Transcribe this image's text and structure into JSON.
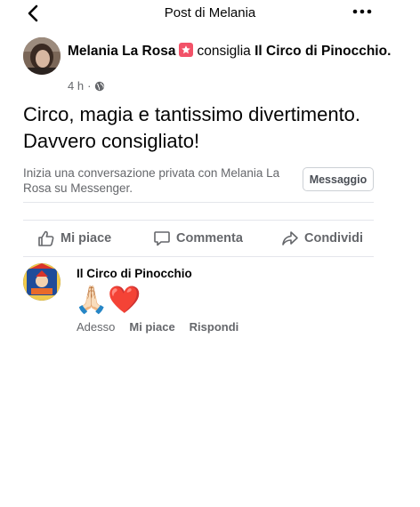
{
  "header": {
    "title": "Post di Melania",
    "back_icon": "chevron-left-icon",
    "more_icon": "more-dots-icon"
  },
  "post": {
    "author": "Melania La Rosa",
    "badge_icon": "recommendation-star-icon",
    "verb": "consiglia",
    "page_name": "Il Circo di Pinocchio.",
    "time": "4 h",
    "separator": "·",
    "privacy_icon": "globe-icon",
    "text": "Circo, magia e tantissimo divertimento. Davvero consigliato!"
  },
  "messenger": {
    "prompt": "Inizia una conversazione privata con Melania La Rosa su Messenger.",
    "button_label": "Messaggio"
  },
  "actions": {
    "like_label": "Mi piace",
    "comment_label": "Commenta",
    "share_label": "Condividi"
  },
  "comment": {
    "author": "Il Circo di Pinocchio",
    "emojis": "🙏🏻❤️",
    "time": "Adesso",
    "like_label": "Mi piace",
    "reply_label": "Rispondi"
  },
  "colors": {
    "secondary_text": "#65676b",
    "badge": "#f25268",
    "divider": "#e4e6eb"
  }
}
